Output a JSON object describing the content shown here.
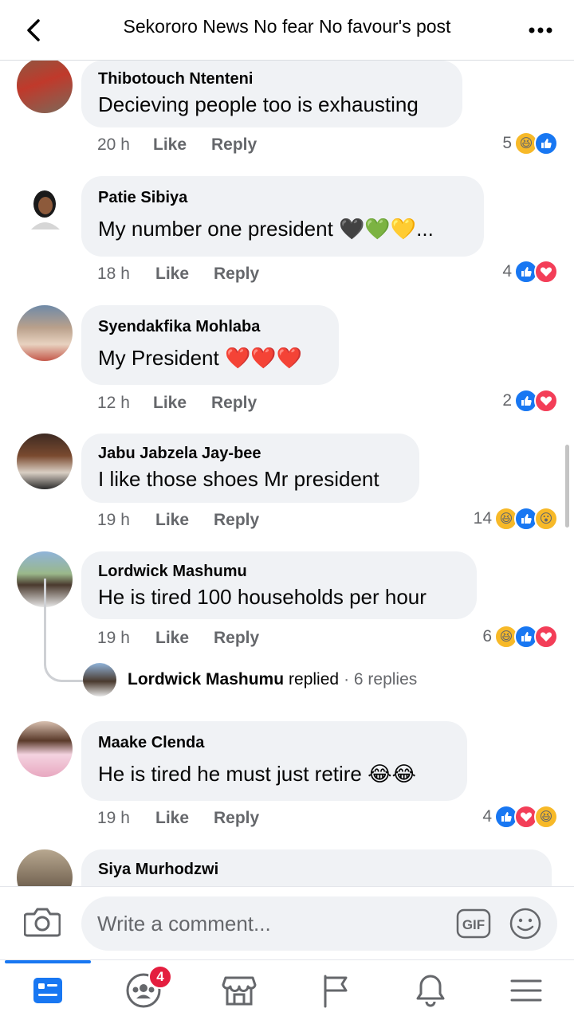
{
  "header": {
    "title": "Sekororo News No fear No favour's post",
    "back_icon": "chevron-left-icon",
    "more_icon": "more-dots-icon"
  },
  "comments": [
    {
      "name": "Thibotouch Ntenteni",
      "text": "Decieving people too is exhausting",
      "time": "20 h",
      "like": "Like",
      "reply": "Reply",
      "reaction_count": "5",
      "reactions": [
        "haha",
        "like"
      ]
    },
    {
      "name": "Patie Sibiya",
      "text": "My number one president 🖤💚💛...",
      "time": "18 h",
      "like": "Like",
      "reply": "Reply",
      "reaction_count": "4",
      "reactions": [
        "like",
        "love"
      ]
    },
    {
      "name": "Syendakfika Mohlaba",
      "text": "My President ❤️❤️❤️",
      "time": "12 h",
      "like": "Like",
      "reply": "Reply",
      "reaction_count": "2",
      "reactions": [
        "like",
        "love"
      ]
    },
    {
      "name": "Jabu Jabzela Jay-bee",
      "text": "I like those shoes Mr president",
      "time": "19 h",
      "like": "Like",
      "reply": "Reply",
      "reaction_count": "14",
      "reactions": [
        "haha",
        "like",
        "wow"
      ]
    },
    {
      "name": "Lordwick Mashumu",
      "text": "He is tired 100 households per  hour",
      "time": "19 h",
      "like": "Like",
      "reply": "Reply",
      "reaction_count": "6",
      "reactions": [
        "haha",
        "like",
        "love"
      ]
    },
    {
      "name": "Maake Clenda",
      "text": "He is tired he must just retire 😂😂",
      "time": "19 h",
      "like": "Like",
      "reply": "Reply",
      "reaction_count": "4",
      "reactions": [
        "like",
        "love",
        "haha"
      ]
    },
    {
      "name": "Siya Murhodzwi",
      "text": ""
    }
  ],
  "replies_preview": {
    "name": "Lordwick Mashumu",
    "action": "replied",
    "count": "· 6 replies"
  },
  "composer": {
    "placeholder": "Write a comment...",
    "gif_label": "GIF"
  },
  "nav": {
    "items": [
      "home-news-icon",
      "groups-icon",
      "marketplace-icon",
      "pages-flag-icon",
      "notifications-bell-icon",
      "menu-icon"
    ],
    "groups_badge": "4"
  },
  "colors": {
    "accent": "#1877f2",
    "love": "#f33e58",
    "haha": "#f7b928",
    "bubble": "#f0f2f5",
    "secondary_text": "#65676b"
  }
}
